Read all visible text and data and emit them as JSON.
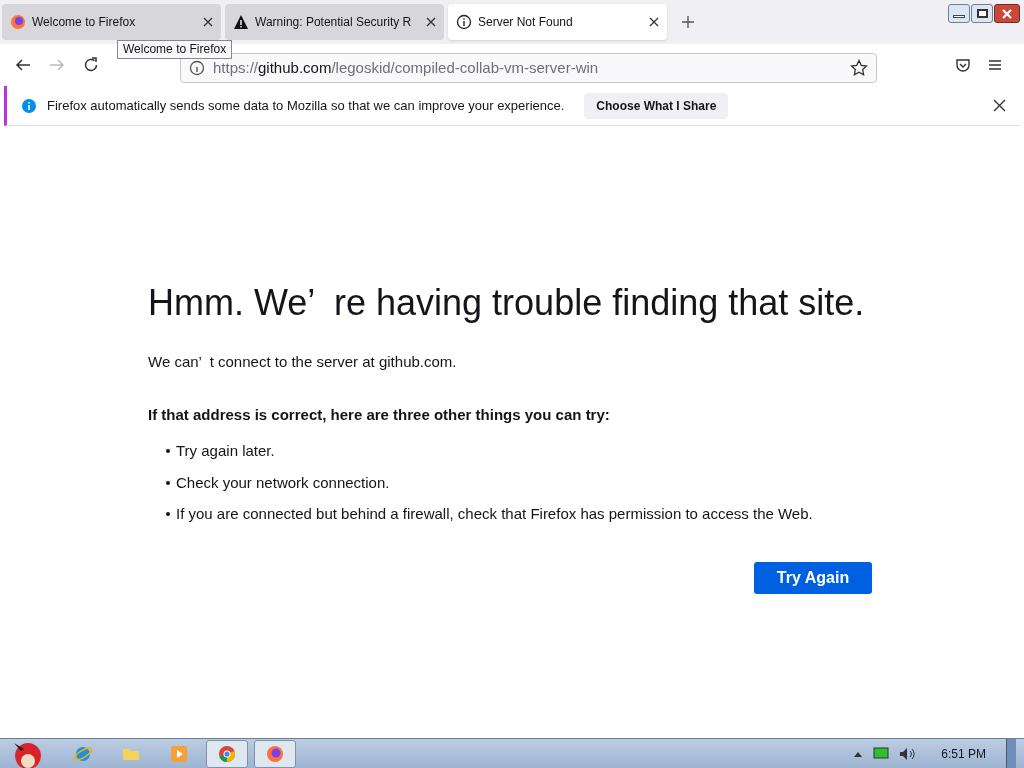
{
  "tabs": [
    {
      "title": "Welcome to Firefox",
      "kind": "firefox",
      "selected": false
    },
    {
      "title": "Warning: Potential Security R",
      "kind": "warning",
      "selected": false
    },
    {
      "title": "Server Not Found",
      "kind": "info",
      "selected": true
    }
  ],
  "tooltip": "Welcome to Firefox",
  "address_bar": {
    "host_prefix": "https://",
    "host": "github.com",
    "path": "/legoskid/compiled-collab-vm-server-win"
  },
  "notification": {
    "message": "Firefox automatically sends some data to Mozilla so that we can improve your experience.",
    "button": "Choose What I Share"
  },
  "error": {
    "title": "Hmm. We’  re having trouble finding that site.",
    "description": "We can’  t connect to the server at github.com.",
    "suggestions_heading": "If that address is correct, here are three other things you can try:",
    "suggestions": [
      "Try again later.",
      "Check your network connection.",
      "If you are connected but behind a firewall, check that Firefox has permission to access the Web."
    ],
    "button": "Try Again"
  },
  "taskbar": {
    "apps": [
      {
        "kind": "ie",
        "active": false
      },
      {
        "kind": "folder",
        "active": false
      },
      {
        "kind": "media",
        "active": false
      },
      {
        "kind": "chrome",
        "active": true
      },
      {
        "kind": "firefox",
        "active": true
      }
    ],
    "clock": "6:51 PM"
  }
}
